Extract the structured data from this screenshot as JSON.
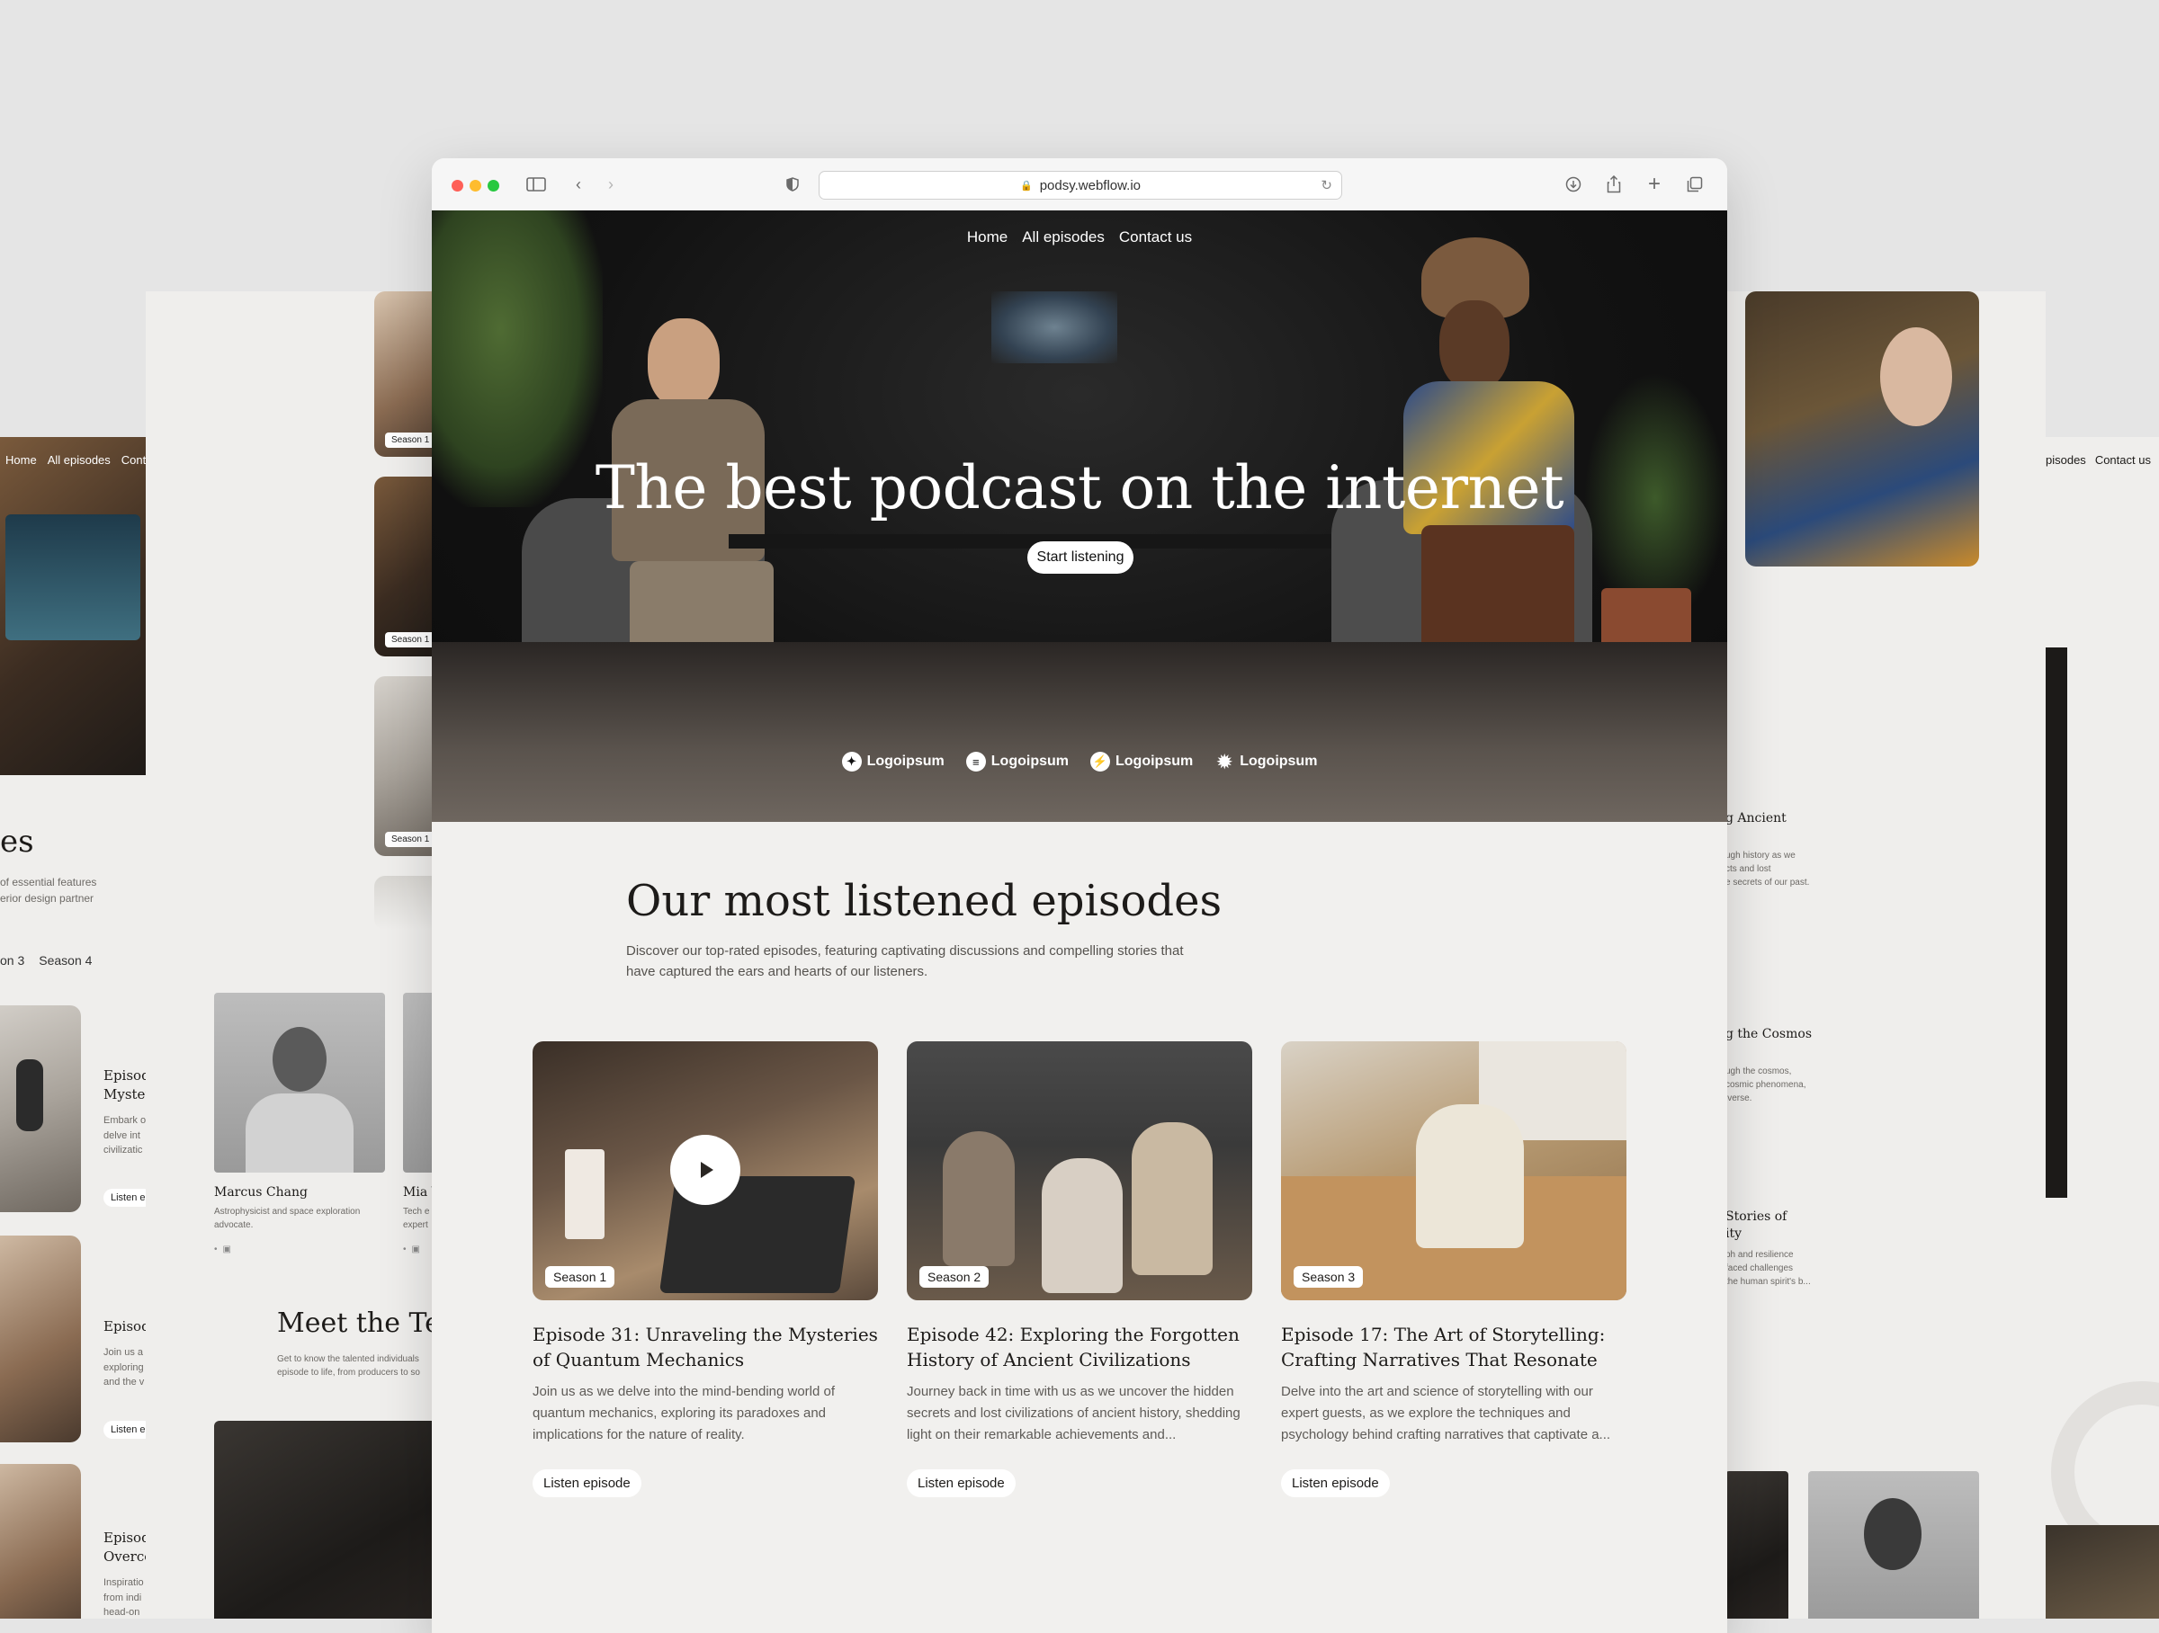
{
  "browser": {
    "url": "podsy.webflow.io"
  },
  "nav": {
    "items": [
      "Home",
      "All episodes",
      "Contact us"
    ]
  },
  "hero": {
    "title": "The best podcast on the internet",
    "button": "Start listening",
    "logos": [
      "Logoipsum",
      "Logoipsum",
      "Logoipsum",
      "Logoipsum"
    ]
  },
  "episodes": {
    "title": "Our most listened episodes",
    "description": "Discover our top-rated episodes, featuring captivating discussions and compelling stories that have captured the ears and hearts of our listeners.",
    "cards": [
      {
        "season": "Season 1",
        "title": "Episode 31: Unraveling the Mysteries of Quantum Mechanics",
        "description": "Join us as we delve into the mind-bending world of quantum mechanics, exploring its paradoxes and implications for the nature of reality.",
        "button": "Listen episode"
      },
      {
        "season": "Season 2",
        "title": "Episode 42: Exploring the Forgotten History of Ancient Civilizations",
        "description": "Journey back in time with us as we uncover the hidden secrets and lost civilizations of ancient history, shedding light on their remarkable achievements and...",
        "button": "Listen episode"
      },
      {
        "season": "Season 3",
        "title": "Episode 17: The Art of Storytelling: Crafting Narratives That Resonate",
        "description": "Delve into the art and science of storytelling with our expert guests, as we explore the techniques and psychology behind crafting narratives that captivate a...",
        "button": "Listen episode"
      }
    ]
  },
  "left_page": {
    "nav": [
      "Home",
      "All episodes",
      "Cont"
    ],
    "heading_fragment": "es",
    "desc_lines": [
      "of essential features",
      "erior design partner"
    ],
    "tabs": [
      "on 3",
      "Season 4"
    ],
    "list": [
      {
        "title_lines": [
          "Episod",
          "Myster"
        ],
        "desc_lines": [
          "Embark o",
          "delve int",
          "civilizatic"
        ],
        "button": "Listen e"
      },
      {
        "title_lines": [
          "Episod"
        ],
        "desc_lines": [
          "Join us a",
          "exploring",
          "and the v"
        ],
        "button": "Listen e"
      },
      {
        "title_lines": [
          "Episod",
          "Overco"
        ],
        "desc_lines": [
          "Inspiratio",
          "from indi",
          "head-on"
        ]
      }
    ]
  },
  "mid_left_page": {
    "badges": [
      "Season 1",
      "Season 1",
      "Season 1"
    ],
    "team": [
      {
        "name": "Marcus Chang",
        "role": "Astrophysicist and space exploration advocate."
      },
      {
        "name": "Mia V",
        "role": "Tech e expert"
      }
    ],
    "meet_title": "Meet the Te",
    "meet_desc": "Get to know the talented individuals episode to life, from producers to so"
  },
  "right_page": {
    "nav": [
      "pisodes",
      "Contact us"
    ],
    "items": [
      {
        "title": "g Ancient",
        "desc_lines": [
          "ugh history as we",
          "cts and lost",
          "e secrets of our past."
        ]
      },
      {
        "title": "g the Cosmos",
        "desc_lines": [
          "ugh the cosmos,",
          "cosmic phenomena,",
          "iverse."
        ]
      },
      {
        "title_lines": [
          "Stories of",
          "ity"
        ],
        "desc_lines": [
          "ph and resilience",
          "faced challenges",
          "the human spirit's b..."
        ]
      }
    ]
  },
  "colors": {
    "accent_text": "#1d1b19",
    "page_bg": "#f1f0ee",
    "desk_bg": "#e5e5e5"
  }
}
